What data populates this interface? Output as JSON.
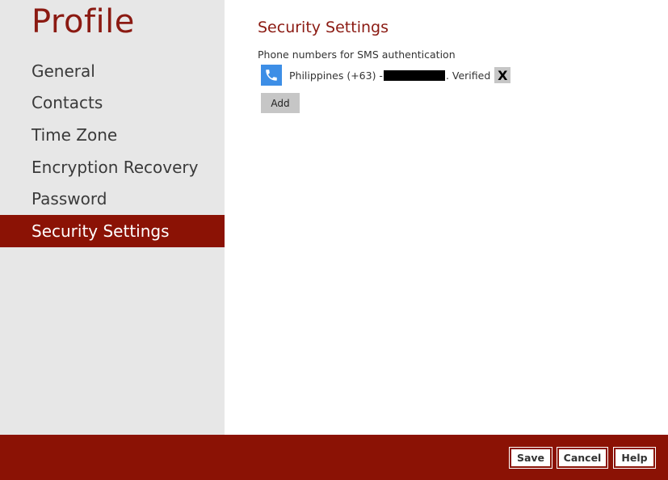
{
  "sidebar": {
    "title": "Profile",
    "items": [
      {
        "label": "General"
      },
      {
        "label": "Contacts"
      },
      {
        "label": "Time Zone"
      },
      {
        "label": "Encryption Recovery"
      },
      {
        "label": "Password"
      },
      {
        "label": "Security Settings",
        "active": true
      }
    ]
  },
  "main": {
    "title": "Security Settings",
    "section_label": "Phone numbers for SMS authentication",
    "phone": {
      "country": "Philippines (+63) -",
      "number": "[redacted]",
      "status": ". Verified",
      "remove_label": "X",
      "icon": "phone-icon"
    },
    "add_label": "Add"
  },
  "footer": {
    "save_label": "Save",
    "cancel_label": "Cancel",
    "help_label": "Help"
  },
  "colors": {
    "accent": "#8b1205",
    "sidebar_bg": "#e7e7e7",
    "phone_icon_bg": "#3d8ee6"
  }
}
